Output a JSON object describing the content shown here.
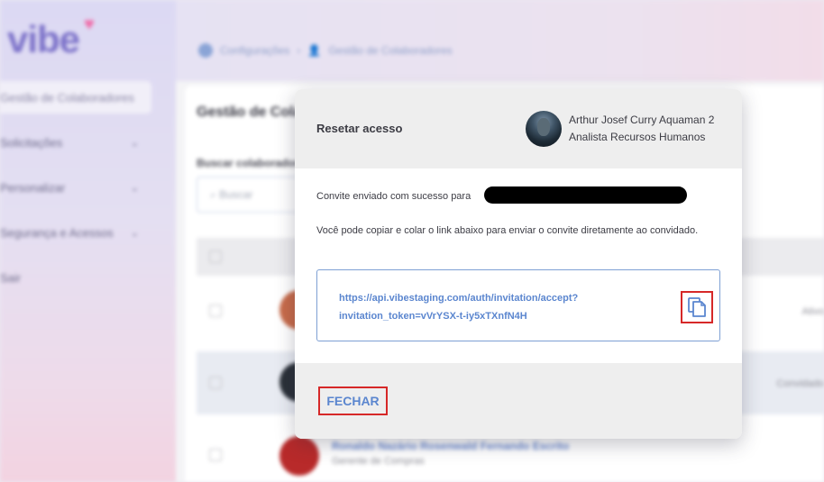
{
  "app": {
    "logo_text": "vibe",
    "sidebar": {
      "items": [
        {
          "label": "Gestão de Colaboradores"
        },
        {
          "label": "Solicitações"
        },
        {
          "label": "Personalizar"
        },
        {
          "label": "Segurança e Acessos"
        },
        {
          "label": "Sair"
        }
      ]
    },
    "breadcrumb": [
      "Configurações",
      "Gestão de Colaboradores"
    ],
    "page_title": "Gestão de Colaboradores",
    "search": {
      "label": "Buscar colaborador",
      "placeholder": "Buscar"
    },
    "rows": [
      {
        "name": "",
        "subtitle": "",
        "status": "Ativo"
      },
      {
        "name": "",
        "subtitle": "",
        "status": "Convidado"
      },
      {
        "name": "Ronaldo Nazário Rosenwald Fernando Escrito",
        "subtitle": "Gerente de Compras",
        "status": ""
      }
    ]
  },
  "modal": {
    "title": "Resetar acesso",
    "user": {
      "name": "Arthur Josef Curry Aquaman 2",
      "role": "Analista Recursos Humanos"
    },
    "success_message": "Convite enviado com sucesso para",
    "instruction": "Você pode copiar e colar o link abaixo para enviar o convite diretamente ao convidado.",
    "invitation_link": "https://api.vibestaging.com/auth/invitation/accept?invitation_token=vVrYSX-t-iy5xTXnfN4H",
    "copy_icon": "copy-icon",
    "close_label": "FECHAR"
  },
  "colors": {
    "accent": "#5b86cf",
    "highlight_border": "#d62828",
    "brand": "#7c72c9"
  }
}
